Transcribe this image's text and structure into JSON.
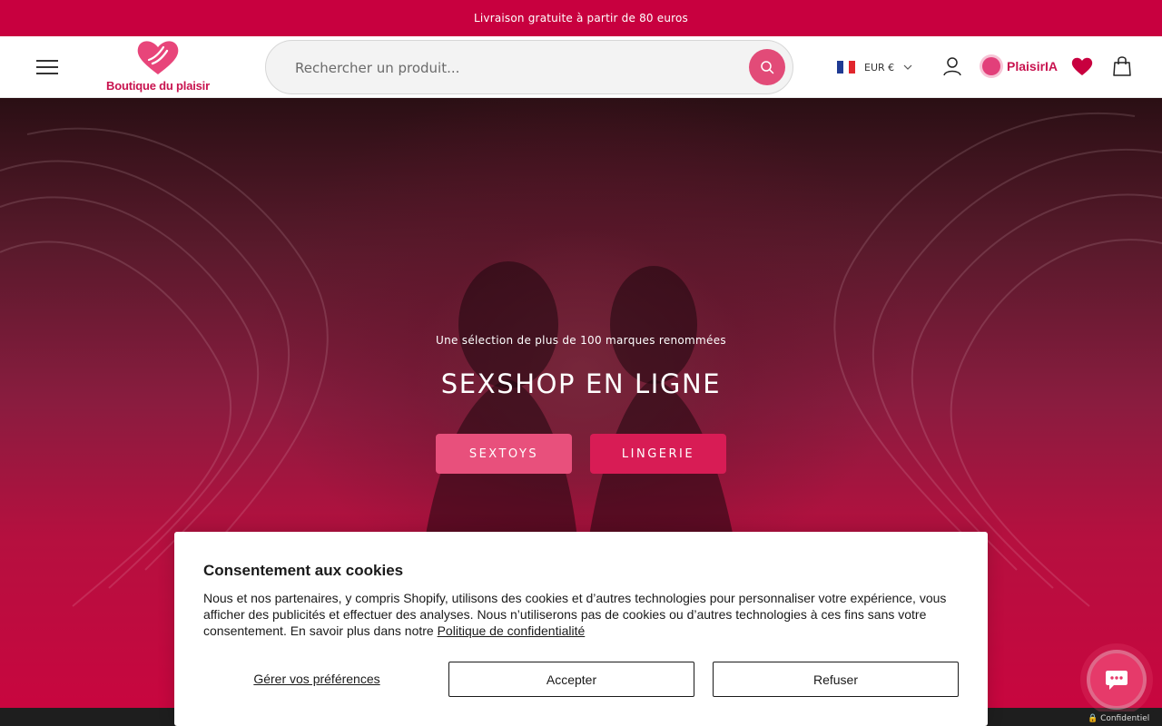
{
  "announcement": {
    "text": "Livraison gratuite à partir de 80 euros"
  },
  "header": {
    "logo_text": "Boutique du plaisir",
    "search_placeholder": "Rechercher un produit...",
    "currency_label": "EUR €",
    "assistant_label": "PlaisirIA"
  },
  "hero": {
    "subtitle": "Une sélection de plus de 100 marques renommées",
    "title": "SEXSHOP EN LIGNE",
    "buttons": [
      {
        "label": "SEXTOYS"
      },
      {
        "label": "LINGERIE"
      }
    ]
  },
  "cookie": {
    "title": "Consentement aux cookies",
    "body": "Nous et nos partenaires, y compris Shopify, utilisons des cookies et d’autres technologies pour personnaliser votre expérience, vous afficher des publicités et effectuer des analyses. Nous n’utiliserons pas de cookies ou d’autres technologies à ces fins sans votre consentement. En savoir plus dans notre",
    "policy_link": "Politique de confidentialité",
    "preferences": "Gérer vos préférences",
    "accept": "Accepter",
    "refuse": "Refuser"
  },
  "chat": {
    "badge": "🔒 Confidentiel"
  },
  "colors": {
    "brand": "#c8003f",
    "accent_pink": "#e8507c",
    "accent_deep": "#d81c55"
  },
  "icons": [
    "menu-icon",
    "logo-heart-icon",
    "search-icon",
    "france-flag-icon",
    "chevron-down-icon",
    "user-icon",
    "assistant-avatar-icon",
    "heart-icon",
    "bag-icon",
    "chat-icon",
    "lock-icon"
  ]
}
